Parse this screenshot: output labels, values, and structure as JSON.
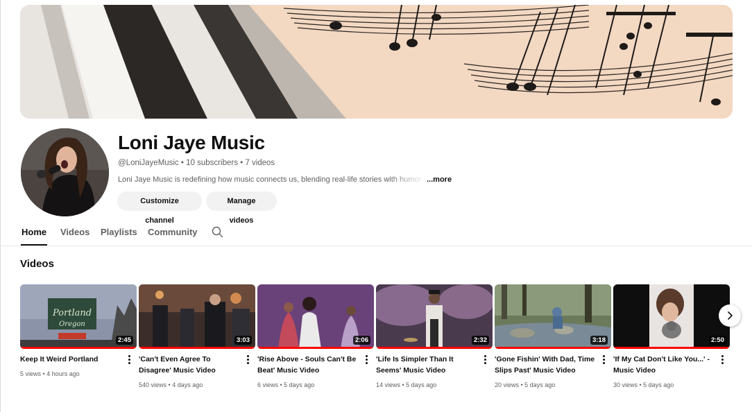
{
  "channel": {
    "name": "Loni Jaye Music",
    "meta": "@LoniJayeMusic • 10 subscribers • 7 videos",
    "description": "Loni Jaye Music is redefining how music connects us, blending real-life stories with humor",
    "more_label": "...more",
    "buttons": {
      "customize": "Customize channel",
      "manage": "Manage videos"
    }
  },
  "tabs": [
    {
      "label": "Home",
      "active": true
    },
    {
      "label": "Videos",
      "active": false
    },
    {
      "label": "Playlists",
      "active": false
    },
    {
      "label": "Community",
      "active": false
    }
  ],
  "icons": {
    "search": "search-icon",
    "more": "more-vert-icon",
    "next": "chevron-right-icon"
  },
  "section": {
    "title": "Videos"
  },
  "videos": [
    {
      "title": "Keep It Weird Portland",
      "views": "5 views",
      "age": "4 hours ago",
      "duration": "2:45"
    },
    {
      "title": "'Can't Even Agree To Disagree' Music Video",
      "views": "540 views",
      "age": "4 days ago",
      "duration": "3:03"
    },
    {
      "title": "'Rise Above - Souls Can't Be Beat' Music Video",
      "views": "6 views",
      "age": "5 days ago",
      "duration": "2:06"
    },
    {
      "title": "'Life Is Simpler Than It Seems' Music Video",
      "views": "14 views",
      "age": "5 days ago",
      "duration": "2:32"
    },
    {
      "title": "'Gone Fishin' With Dad, Time Slips Past' Music Video",
      "views": "20 views",
      "age": "5 days ago",
      "duration": "3:18"
    },
    {
      "title": "'If My Cat Don't Like You...' - Music Video",
      "views": "30 views",
      "age": "5 days ago",
      "duration": "2:50"
    }
  ],
  "colors": {
    "accent_progress": "#ff0000",
    "text_primary": "#0f0f0f",
    "text_secondary": "#606060",
    "pill_bg": "#f2f2f2"
  }
}
